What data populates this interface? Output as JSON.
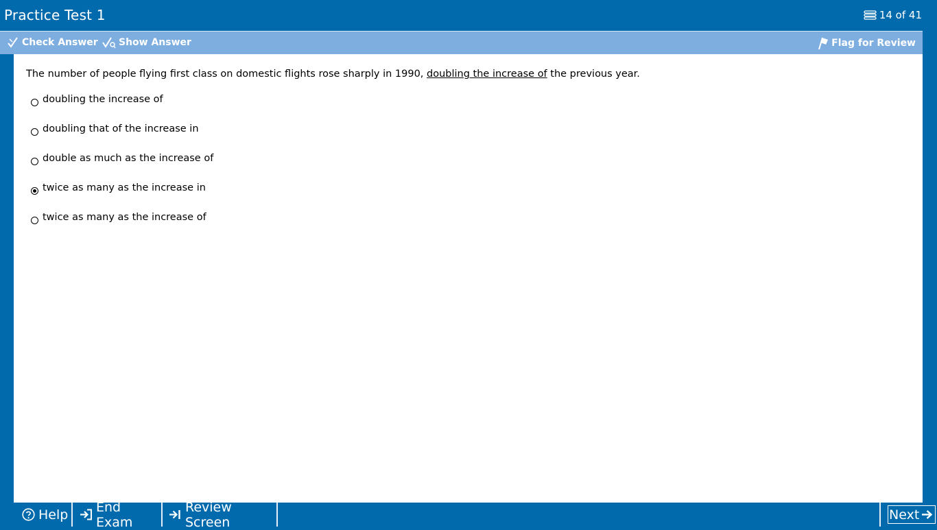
{
  "window": {
    "title": "Practice Test 1",
    "progress": "14 of 41"
  },
  "toolbar": {
    "check_answer": "Check Answer",
    "show_answer": "Show Answer",
    "flag_review": "Flag for Review"
  },
  "question": {
    "text_before": "The number of people flying first class on domestic flights rose sharply in 1990, ",
    "underlined": "doubling the increase of",
    "text_after": " the previous year.",
    "choices": [
      "doubling the increase of",
      "doubling that of the increase in",
      "double as much as the increase of",
      "twice as many as the increase in",
      "twice as many as the increase of"
    ],
    "selected_choice": 3
  },
  "footer": {
    "help": "Help",
    "end_exam": "End Exam",
    "review_screen": "Review Screen",
    "next": "Next"
  },
  "icons": {
    "progress": "stack-icon",
    "check": "check-pencil-icon",
    "show": "show-answer-icon",
    "flag": "flag-icon",
    "help": "question-circle-icon",
    "end": "exit-arrow-icon",
    "review": "arrow-bar-icon",
    "next": "arrow-right-icon"
  },
  "colors": {
    "title_bar": "#016AAD",
    "toolbar": "#7EAEE0",
    "content": "#FFFFFF"
  }
}
